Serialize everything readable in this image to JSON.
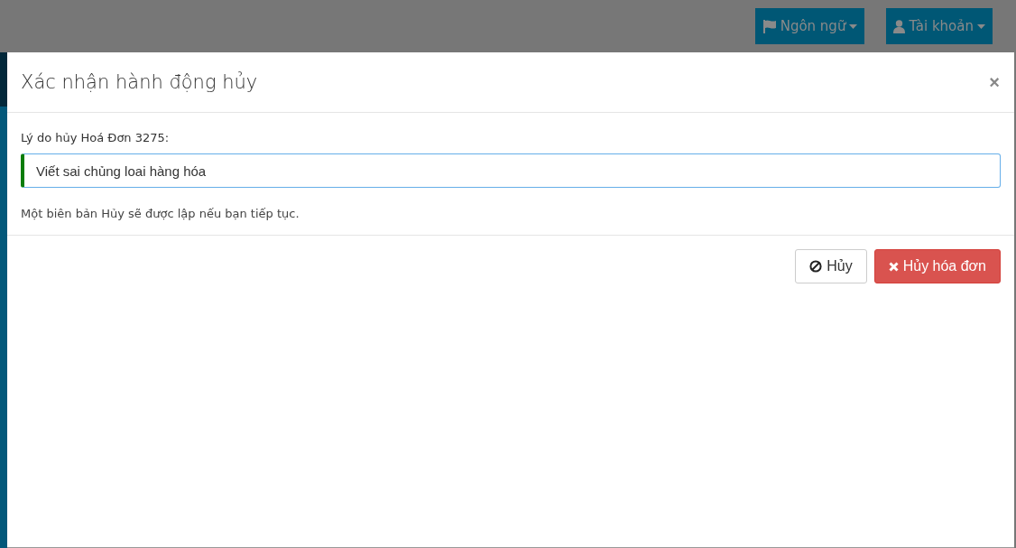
{
  "navbar": {
    "buttons": [
      {
        "kind": "language",
        "label": "Ngôn ngữ"
      },
      {
        "kind": "account",
        "label": "Tài khoản"
      }
    ]
  },
  "dialog": {
    "title": "Xác nhận hành động hủy",
    "close": "×",
    "field_label": "Lý do hủy Hoá Đơn 3275:",
    "reason": {
      "value": "Viết sai chủng loai hàng hóa"
    },
    "note": "Một biên bản Hủy sẽ được lập nếu bạn tiếp tục.",
    "buttons": [
      {
        "kind": "cancel",
        "label": "Hủy"
      },
      {
        "kind": "danger",
        "label": "Hủy hóa đơn"
      }
    ]
  }
}
